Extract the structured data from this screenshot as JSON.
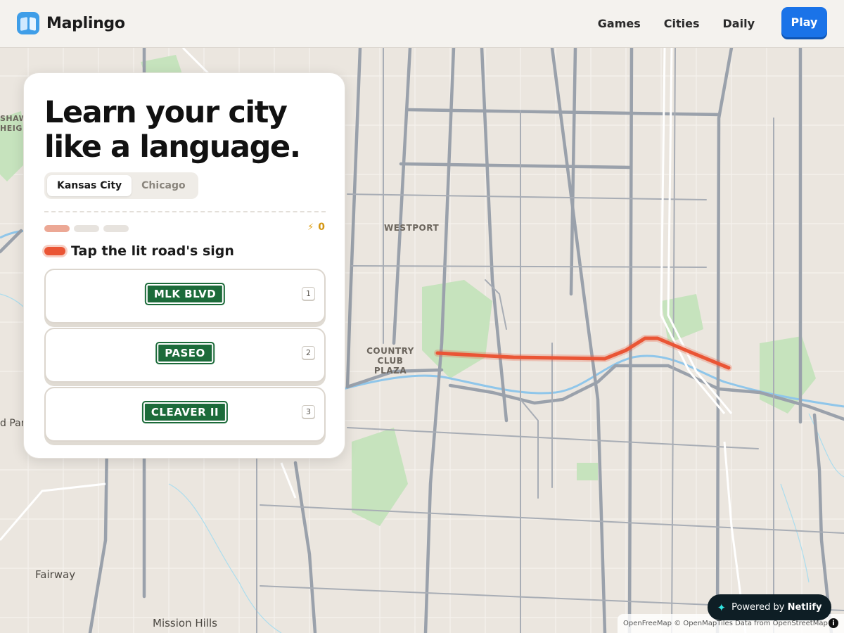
{
  "header": {
    "brand": "Maplingo",
    "nav": [
      "Games",
      "Cities",
      "Daily"
    ],
    "play_label": "Play"
  },
  "map": {
    "labels": {
      "westport": "WESTPORT",
      "country_club_plaza": "COUNTRY CLUB PLAZA",
      "fairway": "Fairway",
      "mission_hills": "Mission Hills",
      "shaw_heights": "SHAW HEIG",
      "park": "d Par"
    },
    "highlight_color": "#ea5535",
    "road_color": "#9aa1ab",
    "water_color": "#8fc6ea",
    "park_color": "#c6e3bd"
  },
  "card": {
    "headline_line1": "Learn your city",
    "headline_line2": "like a language.",
    "cities": [
      "Kansas City",
      "Chicago"
    ],
    "active_city": "Kansas City",
    "progress_total": 3,
    "progress_current": 1,
    "score": "0",
    "prompt": "Tap the lit road's sign",
    "answers": [
      {
        "sign": "MLK BLVD",
        "key": "1"
      },
      {
        "sign": "PASEO",
        "key": "2"
      },
      {
        "sign": "CLEAVER II",
        "key": "3"
      }
    ]
  },
  "footer": {
    "netlify_prefix": "Powered by",
    "netlify_brand": "Netlify",
    "attribution": "OpenFreeMap © OpenMapTiles Data from OpenStreetMap",
    "info": "i"
  }
}
